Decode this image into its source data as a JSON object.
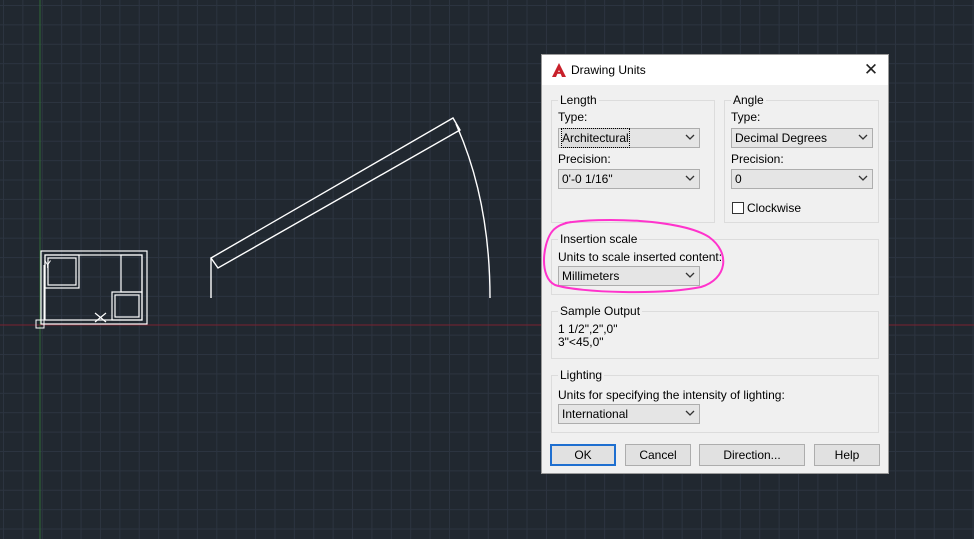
{
  "dialog": {
    "title": "Drawing Units",
    "close_glyph": "✕",
    "length": {
      "legend": "Length",
      "type_label": "Type:",
      "type_value": "Architectural",
      "precision_label": "Precision:",
      "precision_value": "0'-0 1/16\""
    },
    "angle": {
      "legend": "Angle",
      "type_label": "Type:",
      "type_value": "Decimal Degrees",
      "precision_label": "Precision:",
      "precision_value": "0",
      "clockwise_label": "Clockwise",
      "clockwise_checked": false
    },
    "insertion": {
      "legend": "Insertion scale",
      "units_label": "Units to scale inserted content:",
      "units_value": "Millimeters"
    },
    "sample": {
      "legend": "Sample Output",
      "line1": "1 1/2\",2\",0\"",
      "line2": "3\"<45,0\""
    },
    "lighting": {
      "legend": "Lighting",
      "units_label": "Units for specifying the intensity of lighting:",
      "units_value": "International"
    },
    "buttons": {
      "ok": "OK",
      "cancel": "Cancel",
      "direction": "Direction...",
      "help": "Help"
    }
  },
  "colors": {
    "canvas_bg": "#212830",
    "grid": "#2c3440",
    "annotation": "#ff33cc",
    "app_icon": "#c8202a",
    "default_button_border": "#1e6fd0"
  },
  "icons": {
    "app": "autocad-a-icon",
    "close": "close-icon",
    "dropdown": "chevron-down-icon"
  }
}
